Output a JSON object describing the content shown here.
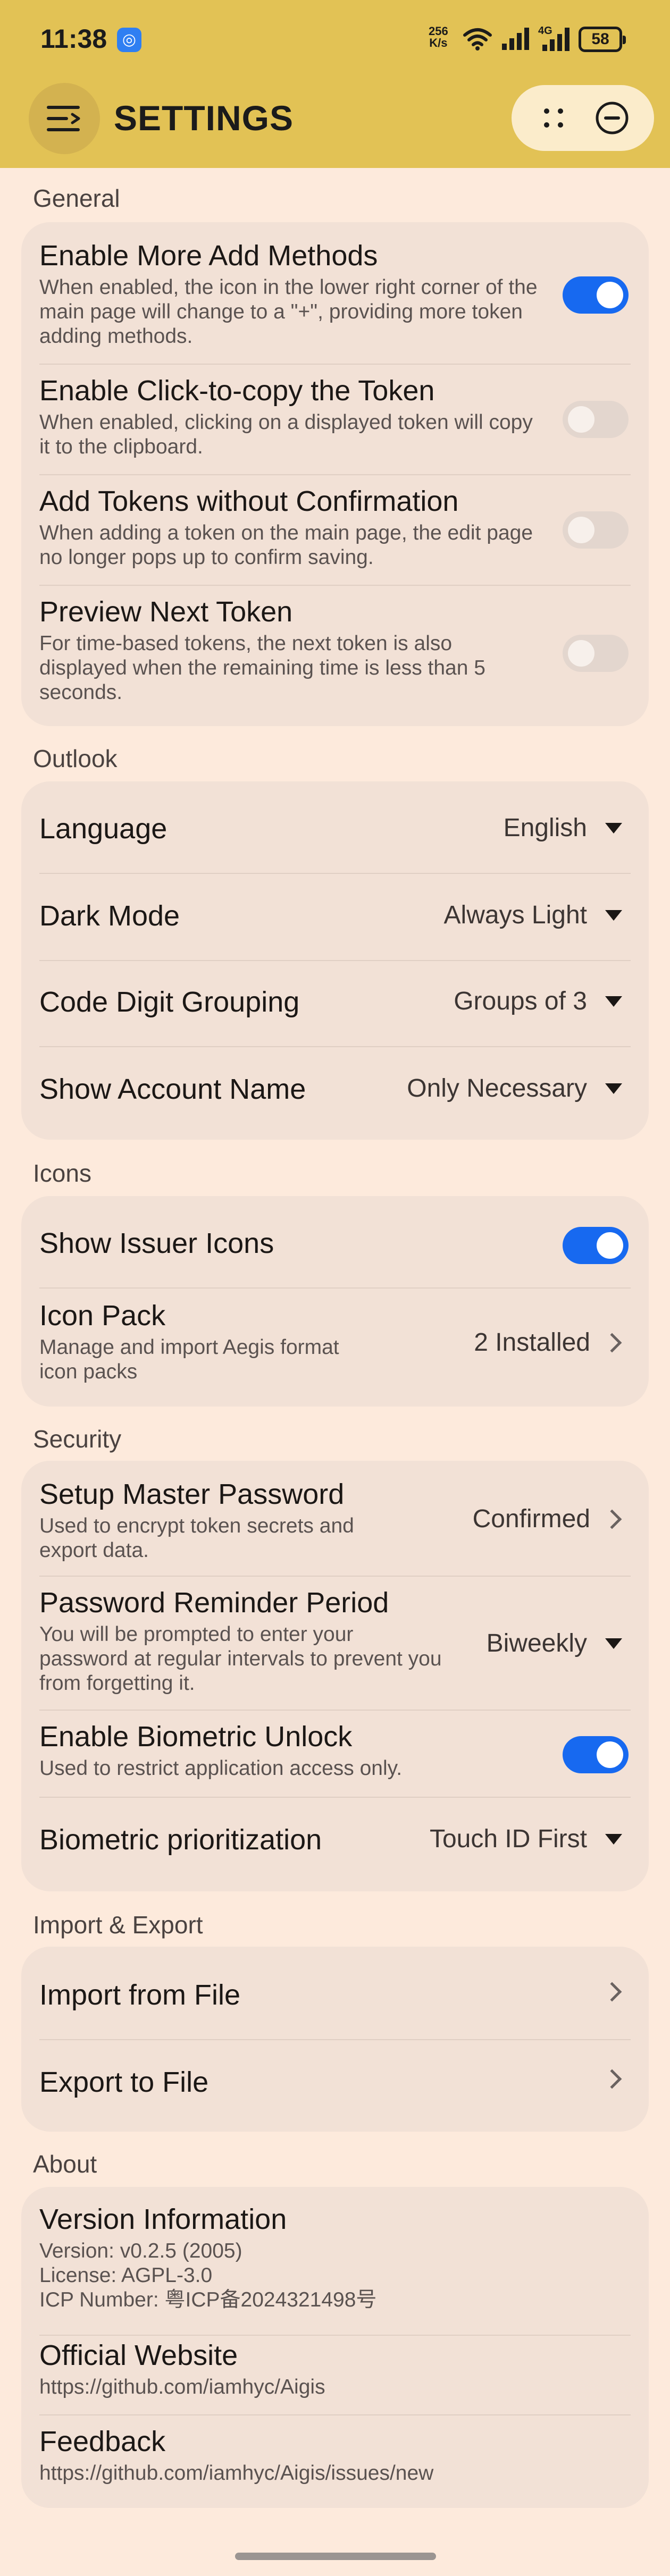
{
  "status": {
    "time": "11:38",
    "net_speed": "256\nK/s",
    "network": "4G",
    "battery": "58"
  },
  "header": {
    "title": "SETTINGS"
  },
  "sections": {
    "general": {
      "label": "General",
      "enable_more_add": {
        "title": "Enable More Add Methods",
        "desc": "When enabled, the icon in the lower right corner of the main page will change to a \"+\", providing more token adding methods.",
        "on": true
      },
      "click_to_copy": {
        "title": "Enable Click-to-copy the Token",
        "desc": "When enabled, clicking on a displayed token will copy it to the clipboard.",
        "on": false
      },
      "add_without_confirm": {
        "title": "Add Tokens without Confirmation",
        "desc": "When adding a token on the main page, the edit page no longer pops up to confirm saving.",
        "on": false
      },
      "preview_next": {
        "title": "Preview Next Token",
        "desc": "For time-based tokens, the next token is also displayed when the remaining time is less than 5 seconds.",
        "on": false
      }
    },
    "outlook": {
      "label": "Outlook",
      "language": {
        "title": "Language",
        "value": "English"
      },
      "dark_mode": {
        "title": "Dark Mode",
        "value": "Always Light"
      },
      "digit_grouping": {
        "title": "Code Digit Grouping",
        "value": "Groups of 3"
      },
      "account_name": {
        "title": "Show Account Name",
        "value": "Only Necessary"
      }
    },
    "icons": {
      "label": "Icons",
      "show_issuer": {
        "title": "Show Issuer Icons",
        "on": true
      },
      "icon_pack": {
        "title": "Icon Pack",
        "desc": "Manage and import Aegis format icon packs",
        "value": "2 Installed"
      }
    },
    "security": {
      "label": "Security",
      "master_password": {
        "title": "Setup Master Password",
        "desc": "Used to encrypt token secrets and export data.",
        "value": "Confirmed"
      },
      "reminder": {
        "title": "Password Reminder Period",
        "desc": "You will be prompted to enter your password at regular intervals to prevent you from forgetting it.",
        "value": "Biweekly"
      },
      "biometric": {
        "title": "Enable Biometric Unlock",
        "desc": "Used to restrict application access only.",
        "on": true
      },
      "biometric_priority": {
        "title": "Biometric prioritization",
        "value": "Touch ID First"
      }
    },
    "import_export": {
      "label": "Import & Export",
      "import": {
        "title": "Import from File"
      },
      "export": {
        "title": "Export to File"
      }
    },
    "about": {
      "label": "About",
      "version": {
        "title": "Version Information",
        "line1": "Version: v0.2.5 (2005)",
        "line2": "License: AGPL-3.0",
        "line3": "ICP Number: 粤ICP备2024321498号"
      },
      "website": {
        "title": "Official Website",
        "url": "https://github.com/iamhyc/Aigis"
      },
      "feedback": {
        "title": "Feedback",
        "url": "https://github.com/iamhyc/Aigis/issues/new"
      }
    }
  }
}
